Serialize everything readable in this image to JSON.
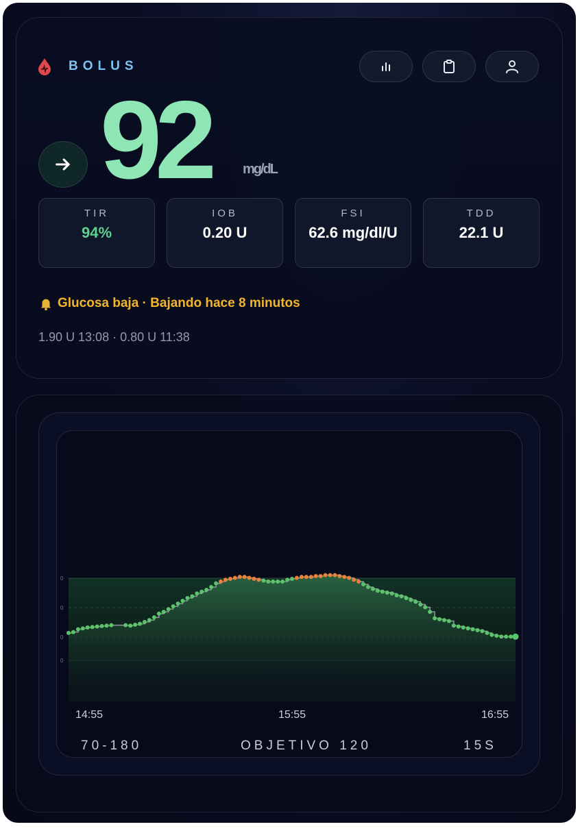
{
  "app": {
    "brand": "BOLUS",
    "icons": {
      "brand": "blood-drop-icon",
      "chart": "bar-chart-icon",
      "log": "clipboard-icon",
      "profile": "user-icon",
      "trend": "arrow-right-icon",
      "alert": "bell-icon"
    }
  },
  "reading": {
    "value": "92",
    "unit": "mg/dL",
    "color": "#8ee6b5"
  },
  "stats": [
    {
      "label": "TIR",
      "value": "94%",
      "highlight": true
    },
    {
      "label": "IOB",
      "value": "0.20 U",
      "highlight": false
    },
    {
      "label": "FSI",
      "value": "62.6 mg/dl/U",
      "highlight": false
    },
    {
      "label": "TDD",
      "value": "22.1 U",
      "highlight": false
    }
  ],
  "alert": {
    "text": "Glucosa baja · Bajando hace 8 minutos",
    "color": "#f2b52a"
  },
  "recent_doses": "1.90 U 13:08 · 0.80 U 11:38",
  "footer": {
    "range": "70-180",
    "target": "OBJETIVO 120",
    "interval": "15S"
  },
  "chart_data": {
    "type": "line",
    "x_ticks": [
      "14:55",
      "15:55",
      "16:55"
    ],
    "y_ticks": [
      "0",
      "0",
      "0",
      "0"
    ],
    "colors": {
      "in_range": "#5bc46a",
      "high": "#e8823a",
      "band": "#1e4d35"
    },
    "series": [
      {
        "values": [
          [
            0,
            12
          ],
          [
            1,
            13
          ],
          [
            2,
            16
          ],
          [
            3,
            17
          ],
          [
            4,
            18
          ],
          [
            5,
            18.5
          ],
          [
            6,
            19
          ],
          [
            7,
            19.5
          ],
          [
            8,
            20
          ],
          [
            9,
            20.5
          ],
          [
            12,
            20.5
          ],
          [
            13,
            20
          ],
          [
            14,
            21
          ],
          [
            15,
            22
          ],
          [
            16,
            24
          ],
          [
            17,
            26
          ],
          [
            18,
            29
          ],
          [
            19,
            33
          ],
          [
            20,
            35
          ],
          [
            21,
            38
          ],
          [
            22,
            41
          ],
          [
            23,
            44
          ],
          [
            24,
            47
          ],
          [
            25,
            50
          ],
          [
            26,
            52
          ],
          [
            27,
            55
          ],
          [
            28,
            57
          ],
          [
            29,
            59
          ],
          [
            30,
            62
          ],
          [
            31,
            66
          ],
          [
            32,
            68
          ],
          [
            33,
            70
          ],
          [
            34,
            71
          ],
          [
            35,
            72
          ],
          [
            36,
            73
          ],
          [
            37,
            73
          ],
          [
            38,
            72
          ],
          [
            39,
            71
          ],
          [
            40,
            70
          ],
          [
            41,
            69
          ],
          [
            42,
            68
          ],
          [
            43,
            68
          ],
          [
            44,
            68
          ],
          [
            45,
            68
          ],
          [
            46,
            70
          ],
          [
            47,
            71
          ],
          [
            48,
            72
          ],
          [
            49,
            73
          ],
          [
            50,
            73
          ],
          [
            51,
            73
          ],
          [
            52,
            74
          ],
          [
            53,
            74
          ],
          [
            54,
            75
          ],
          [
            55,
            75
          ],
          [
            56,
            75
          ],
          [
            57,
            74
          ],
          [
            58,
            73
          ],
          [
            59,
            72
          ],
          [
            60,
            70
          ],
          [
            61,
            68
          ],
          [
            62,
            65
          ],
          [
            63,
            62
          ],
          [
            64,
            60
          ],
          [
            65,
            58
          ],
          [
            66,
            57
          ],
          [
            67,
            56
          ],
          [
            68,
            55
          ],
          [
            69,
            53
          ],
          [
            70,
            52
          ],
          [
            71,
            50
          ],
          [
            72,
            48
          ],
          [
            73,
            46
          ],
          [
            74,
            43
          ],
          [
            75,
            40
          ],
          [
            76,
            35
          ],
          [
            77,
            28
          ],
          [
            78,
            27
          ],
          [
            79,
            26
          ],
          [
            80,
            25
          ],
          [
            81,
            20
          ],
          [
            82,
            19
          ],
          [
            83,
            18
          ],
          [
            84,
            17
          ],
          [
            85,
            16
          ],
          [
            86,
            15
          ],
          [
            87,
            14
          ],
          [
            88,
            12
          ],
          [
            89,
            10
          ],
          [
            90,
            9
          ],
          [
            91,
            8
          ],
          [
            92,
            8
          ],
          [
            93,
            8
          ],
          [
            94,
            8
          ]
        ],
        "high_indices": [
          30,
          31,
          32,
          33,
          34,
          35,
          36,
          37,
          38,
          46,
          47,
          48,
          49,
          50,
          51,
          52,
          53,
          54,
          55,
          56,
          57,
          58,
          59
        ]
      }
    ],
    "ylim": [
      0,
      100
    ],
    "target_band": [
      0,
      70
    ]
  }
}
